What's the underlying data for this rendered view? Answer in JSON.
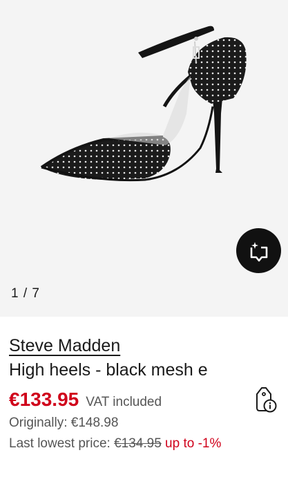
{
  "gallery": {
    "counter": "1 / 7",
    "image_alt": "Steve Madden black mesh rhinestone high heel",
    "similar_icon": "find-similar-icon"
  },
  "product": {
    "brand": "Steve Madden",
    "title": "High heels - black mesh e",
    "price": "€133.95",
    "vat": "VAT included",
    "original": "Originally: €148.98",
    "lowest_prefix": "Last lowest price: ",
    "lowest_price": "€134.95",
    "lowest_delta": "up to -1%",
    "info_icon": "price-tag-info-icon"
  },
  "colors": {
    "price_red": "#d0021b",
    "gallery_bg": "#f4f4f4",
    "text": "#1a1a1a",
    "muted": "#555555"
  }
}
